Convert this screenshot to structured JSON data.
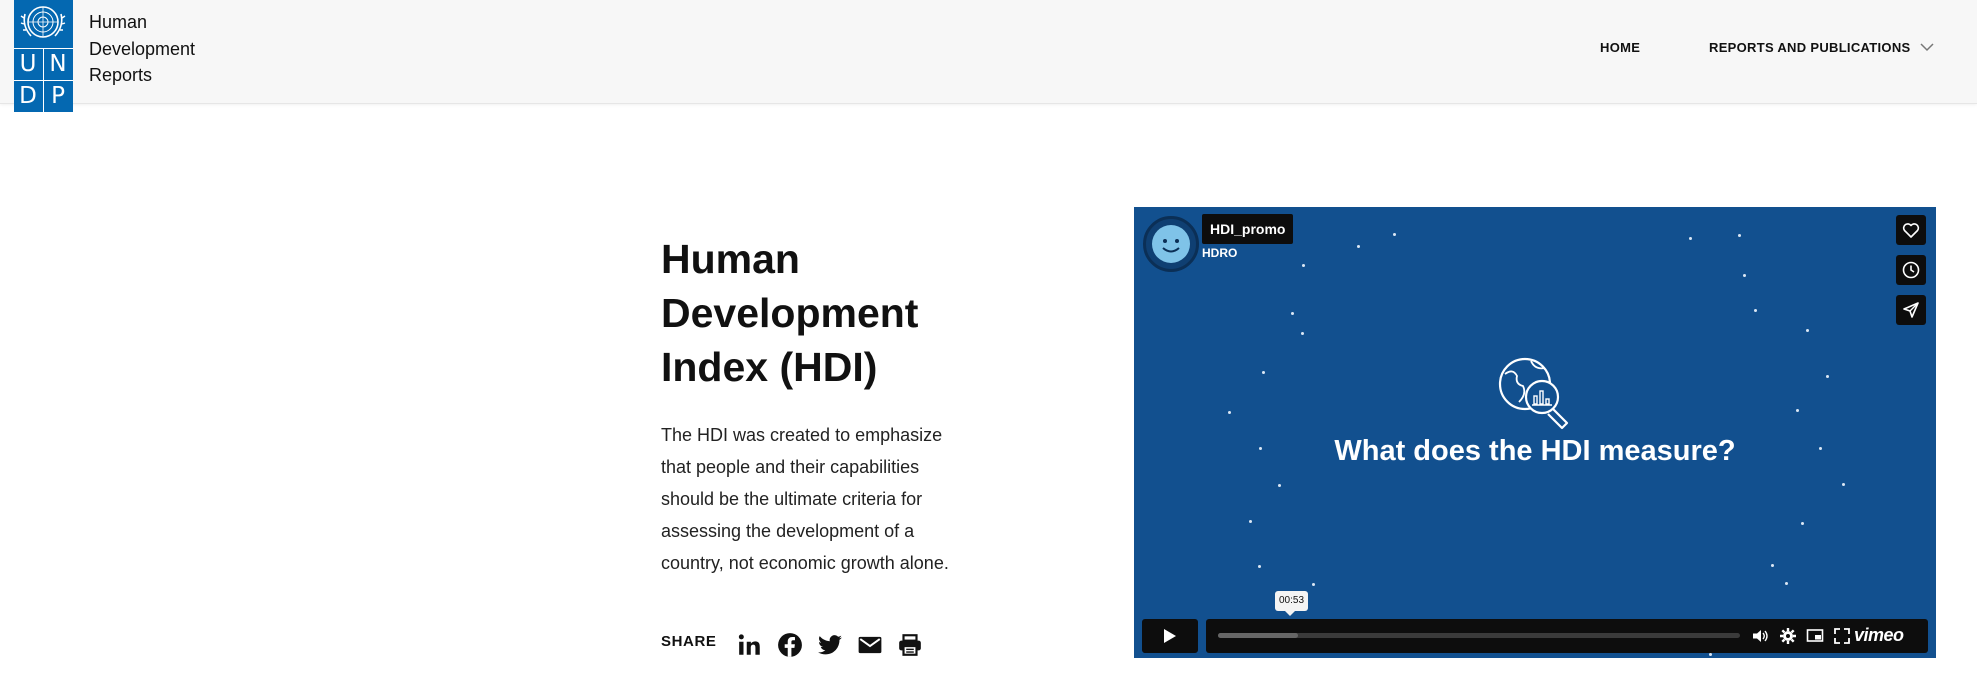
{
  "header": {
    "logo": {
      "letters": [
        "U",
        "N",
        "D",
        "P"
      ],
      "emblem": "un-emblem-icon",
      "background_color": "#0468b1"
    },
    "site_title_lines": [
      "Human",
      "Development",
      "Reports"
    ],
    "nav": {
      "home": "HOME",
      "reports": "REPORTS AND PUBLICATIONS",
      "reports_icon": "chevron-down-icon"
    }
  },
  "main": {
    "title": "Human Development Index (HDI)",
    "intro_lines": [
      "The HDI was created to emphasize",
      "that people and their capabilities",
      "should be the ultimate criteria for",
      "assessing the development of a",
      "country, not economic growth alone."
    ],
    "share": {
      "label": "SHARE",
      "icons": [
        "linkedin-icon",
        "facebook-icon",
        "twitter-icon",
        "email-icon",
        "print-icon"
      ]
    }
  },
  "video": {
    "title": "HDI_promo",
    "owner": "HDRO",
    "question": "What does the HDI measure?",
    "time_tooltip": "00:53",
    "brand": "vimeo",
    "side_buttons": [
      "like-heart-icon",
      "watch-later-clock-icon",
      "share-send-icon"
    ],
    "controls": [
      "play-icon",
      "volume-icon",
      "settings-gear-icon",
      "picture-in-picture-icon",
      "fullscreen-icon"
    ],
    "background_color": "#12508f"
  }
}
